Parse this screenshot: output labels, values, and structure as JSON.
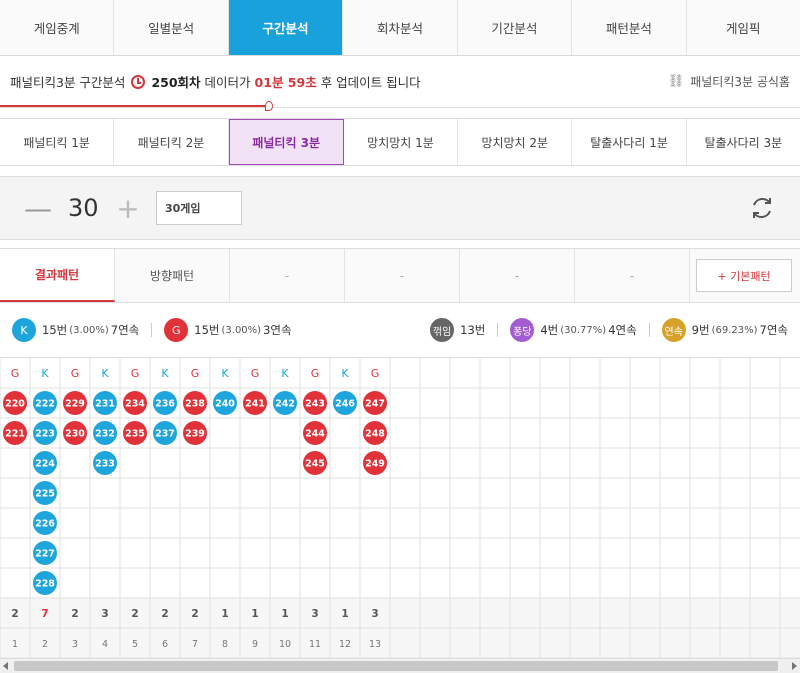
{
  "nav": {
    "tabs": [
      "게임중계",
      "일별분석",
      "구간분석",
      "회차분석",
      "기간분석",
      "패턴분석",
      "게임픽"
    ],
    "active": 2
  },
  "info": {
    "prefix": "패널티킥3분 구간분석",
    "round": "250회차",
    "mid": "데이터가",
    "timer": "01분 59초",
    "suffix": "후 업데이트 됩니다",
    "home_link": "패널티킥3분 공식홈"
  },
  "gametypes": {
    "tabs": [
      "패널티킥 1분",
      "패널티킥 2분",
      "패널티킥 3분",
      "망치망치 1분",
      "망치망치 2분",
      "탈출사다리 1분",
      "탈출사다리 3분"
    ],
    "active": 2
  },
  "count": {
    "minus": "—",
    "value": "30",
    "plus": "+",
    "select": "30게임"
  },
  "pattern_tabs": {
    "tabs": [
      "결과패턴",
      "방향패턴",
      "-",
      "-",
      "-",
      "-"
    ],
    "active": 0,
    "basic_button": "+ 기본패턴"
  },
  "stats": {
    "k": {
      "badge": "K",
      "count": "15번",
      "pct": "(3.00%)",
      "streak": "7연속"
    },
    "g": {
      "badge": "G",
      "count": "15번",
      "pct": "(3.00%)",
      "streak": "3연속"
    },
    "zz": {
      "badge": "꺾임",
      "count": "13번"
    },
    "pd": {
      "badge": "퐁당",
      "count": "4번",
      "pct": "(30.77%)",
      "streak": "4연속"
    },
    "ys": {
      "badge": "연속",
      "count": "9번",
      "pct": "(69.23%)",
      "streak": "7연속"
    }
  },
  "colors": {
    "k": "#1ea6dc",
    "g": "#e03238",
    "accent": "#19a1dc",
    "purple": "#8b2aa6"
  },
  "grid": {
    "columns": [
      {
        "type": "G",
        "values": [
          "220",
          "221"
        ],
        "count": "2",
        "index": "1"
      },
      {
        "type": "K",
        "values": [
          "222",
          "223",
          "224",
          "225",
          "226",
          "227",
          "228"
        ],
        "count": "7",
        "index": "2"
      },
      {
        "type": "G",
        "values": [
          "229",
          "230"
        ],
        "count": "2",
        "index": "3"
      },
      {
        "type": "K",
        "values": [
          "231",
          "232",
          "233"
        ],
        "count": "3",
        "index": "4"
      },
      {
        "type": "G",
        "values": [
          "234",
          "235"
        ],
        "count": "2",
        "index": "5"
      },
      {
        "type": "K",
        "values": [
          "236",
          "237"
        ],
        "count": "2",
        "index": "6"
      },
      {
        "type": "G",
        "values": [
          "238",
          "239"
        ],
        "count": "2",
        "index": "7"
      },
      {
        "type": "K",
        "values": [
          "240"
        ],
        "count": "1",
        "index": "8"
      },
      {
        "type": "G",
        "values": [
          "241"
        ],
        "count": "1",
        "index": "9"
      },
      {
        "type": "K",
        "values": [
          "242"
        ],
        "count": "1",
        "index": "10"
      },
      {
        "type": "G",
        "values": [
          "243",
          "244",
          "245"
        ],
        "count": "3",
        "index": "11"
      },
      {
        "type": "K",
        "values": [
          "246"
        ],
        "count": "1",
        "index": "12"
      },
      {
        "type": "G",
        "values": [
          "247",
          "248",
          "249"
        ],
        "count": "3",
        "index": "13"
      }
    ],
    "highlight_column": 1
  }
}
